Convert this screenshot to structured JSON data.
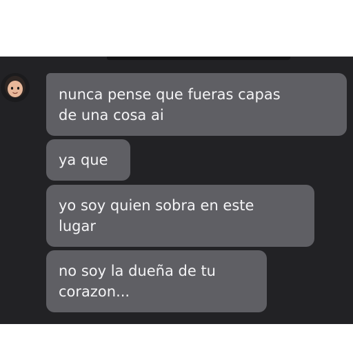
{
  "messages": [
    {
      "text": "nunca pense que fueras capas\nde una cosa ai"
    },
    {
      "text": "ya que"
    },
    {
      "text": "yo soy quien sobra en este\nlugar"
    },
    {
      "text": "no soy la dueña de tu\ncorazon..."
    }
  ],
  "avatar": {
    "icon": "avatar-face-icon"
  },
  "colors": {
    "background": "#222225",
    "bubble": "#5f5f64",
    "text": "#f4f4f6"
  }
}
